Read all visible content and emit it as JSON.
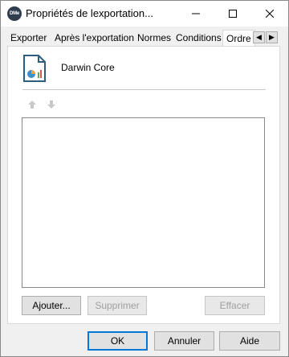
{
  "window": {
    "app_icon_text": "DMe",
    "title": "Propriétés de lexportation...",
    "controls": {
      "minimize": "minimize-icon",
      "maximize": "maximize-icon",
      "close": "close-icon"
    }
  },
  "tabs": [
    {
      "label": "Exporter"
    },
    {
      "label": "Après l'exportation"
    },
    {
      "label": "Normes"
    },
    {
      "label": "Conditions"
    },
    {
      "label": "Ordre"
    }
  ],
  "active_tab": "Ordre",
  "tab_scroll": {
    "left": "◀",
    "right": "▶"
  },
  "panel": {
    "profile_name": "Darwin Core",
    "list_items": [],
    "buttons": {
      "add": "Ajouter...",
      "remove": "Supprimer",
      "clear": "Effacer"
    }
  },
  "footer": {
    "ok": "OK",
    "cancel": "Annuler",
    "help": "Aide"
  },
  "colors": {
    "accent": "#0078d7",
    "document_icon": "#2f5d7c",
    "disabled_text": "#a0a0a0"
  }
}
